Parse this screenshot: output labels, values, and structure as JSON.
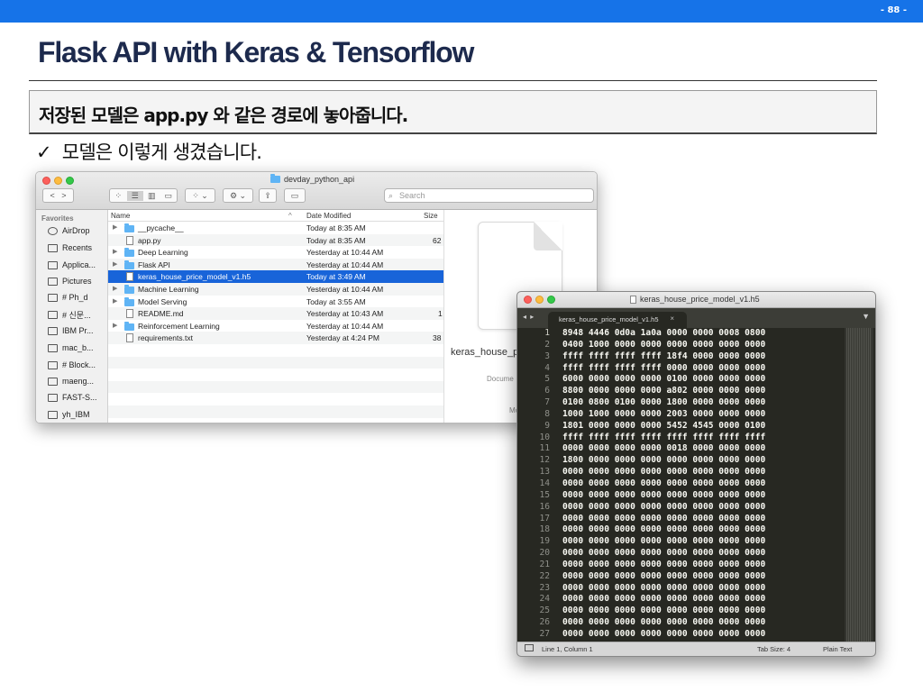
{
  "page_number": "- 88 -",
  "title": "Flask API with Keras & Tensorflow",
  "subtitle": "저장된 모델은 app.py 와 같은 경로에 놓아줍니다.",
  "bullet": {
    "check": "✓",
    "text": "모델은 이렇게 생겼습니다."
  },
  "finder": {
    "window_title": "devday_python_api",
    "search_placeholder": "Search",
    "favorites_label": "Favorites",
    "sidebar": [
      {
        "label": "AirDrop",
        "icon": "airdrop-icon"
      },
      {
        "label": "Recents",
        "icon": "recents-icon"
      },
      {
        "label": "Applica...",
        "icon": "applications-icon"
      },
      {
        "label": "Pictures",
        "icon": "pictures-icon"
      },
      {
        "label": "# Ph_d",
        "icon": "folder-icon"
      },
      {
        "label": "# 신문...",
        "icon": "folder-icon"
      },
      {
        "label": "IBM Pr...",
        "icon": "folder-icon"
      },
      {
        "label": "mac_b...",
        "icon": "folder-icon"
      },
      {
        "label": "# Block...",
        "icon": "folder-icon"
      },
      {
        "label": "maeng...",
        "icon": "home-icon"
      },
      {
        "label": "FAST-S...",
        "icon": "folder-icon"
      },
      {
        "label": "yh_IBM",
        "icon": "folder-icon"
      }
    ],
    "columns": {
      "name": "Name",
      "date": "Date Modified",
      "size": "Size"
    },
    "files": [
      {
        "name": "__pycache__",
        "date": "Today at 8:35 AM",
        "size": "",
        "type": "folder"
      },
      {
        "name": "app.py",
        "date": "Today at 8:35 AM",
        "size": "62",
        "type": "file"
      },
      {
        "name": "Deep Learning",
        "date": "Yesterday at 10:44 AM",
        "size": "",
        "type": "folder"
      },
      {
        "name": "Flask API",
        "date": "Yesterday at 10:44 AM",
        "size": "",
        "type": "folder"
      },
      {
        "name": "keras_house_price_model_v1.h5",
        "date": "Today at 3:49 AM",
        "size": "",
        "type": "file",
        "selected": true
      },
      {
        "name": "Machine Learning",
        "date": "Yesterday at 10:44 AM",
        "size": "",
        "type": "folder"
      },
      {
        "name": "Model Serving",
        "date": "Today at 3:55 AM",
        "size": "",
        "type": "folder"
      },
      {
        "name": "README.md",
        "date": "Yesterday at 10:43 AM",
        "size": "1",
        "type": "file"
      },
      {
        "name": "Reinforcement Learning",
        "date": "Yesterday at 10:44 AM",
        "size": "",
        "type": "folder"
      },
      {
        "name": "requirements.txt",
        "date": "Yesterday at 4:24 PM",
        "size": "38",
        "type": "file"
      }
    ],
    "preview": {
      "name": "keras_house_p",
      "kind": "Docume",
      "modified": "Mo"
    }
  },
  "editor": {
    "window_title": "keras_house_price_model_v1.h5",
    "tab_label": "keras_house_price_model_v1.h5",
    "tab_close": "×",
    "nav": "◂ ▸",
    "dropdown": "▼",
    "lines": [
      {
        "n": "1",
        "t": "8948 4446 0d0a 1a0a 0000 0000 0008 0800"
      },
      {
        "n": "2",
        "t": "0400 1000 0000 0000 0000 0000 0000 0000"
      },
      {
        "n": "3",
        "t": "ffff ffff ffff ffff 18f4 0000 0000 0000"
      },
      {
        "n": "4",
        "t": "ffff ffff ffff ffff 0000 0000 0000 0000"
      },
      {
        "n": "5",
        "t": "6000 0000 0000 0000 0100 0000 0000 0000"
      },
      {
        "n": "6",
        "t": "8800 0000 0000 0000 a802 0000 0000 0000"
      },
      {
        "n": "7",
        "t": "0100 0800 0100 0000 1800 0000 0000 0000"
      },
      {
        "n": "8",
        "t": "1000 1000 0000 0000 2003 0000 0000 0000"
      },
      {
        "n": "9",
        "t": "1801 0000 0000 0000 5452 4545 0000 0100"
      },
      {
        "n": "10",
        "t": "ffff ffff ffff ffff ffff ffff ffff ffff"
      },
      {
        "n": "11",
        "t": "0000 0000 0000 0000 0018 0000 0000 0000"
      },
      {
        "n": "12",
        "t": "1800 0000 0000 0000 0000 0000 0000 0000"
      },
      {
        "n": "13",
        "t": "0000 0000 0000 0000 0000 0000 0000 0000"
      },
      {
        "n": "14",
        "t": "0000 0000 0000 0000 0000 0000 0000 0000"
      },
      {
        "n": "15",
        "t": "0000 0000 0000 0000 0000 0000 0000 0000"
      },
      {
        "n": "16",
        "t": "0000 0000 0000 0000 0000 0000 0000 0000"
      },
      {
        "n": "17",
        "t": "0000 0000 0000 0000 0000 0000 0000 0000"
      },
      {
        "n": "18",
        "t": "0000 0000 0000 0000 0000 0000 0000 0000"
      },
      {
        "n": "19",
        "t": "0000 0000 0000 0000 0000 0000 0000 0000"
      },
      {
        "n": "20",
        "t": "0000 0000 0000 0000 0000 0000 0000 0000"
      },
      {
        "n": "21",
        "t": "0000 0000 0000 0000 0000 0000 0000 0000"
      },
      {
        "n": "22",
        "t": "0000 0000 0000 0000 0000 0000 0000 0000"
      },
      {
        "n": "23",
        "t": "0000 0000 0000 0000 0000 0000 0000 0000"
      },
      {
        "n": "24",
        "t": "0000 0000 0000 0000 0000 0000 0000 0000"
      },
      {
        "n": "25",
        "t": "0000 0000 0000 0000 0000 0000 0000 0000"
      },
      {
        "n": "26",
        "t": "0000 0000 0000 0000 0000 0000 0000 0000"
      },
      {
        "n": "27",
        "t": "0000 0000 0000 0000 0000 0000 0000 0000"
      }
    ],
    "status": {
      "position": "Line 1, Column 1",
      "tab_size": "Tab Size: 4",
      "syntax": "Plain Text"
    }
  },
  "colors": {
    "topbar": "#1673e8",
    "title": "#1d2a4d",
    "selection": "#1864d9",
    "editor_bg": "#272822"
  }
}
